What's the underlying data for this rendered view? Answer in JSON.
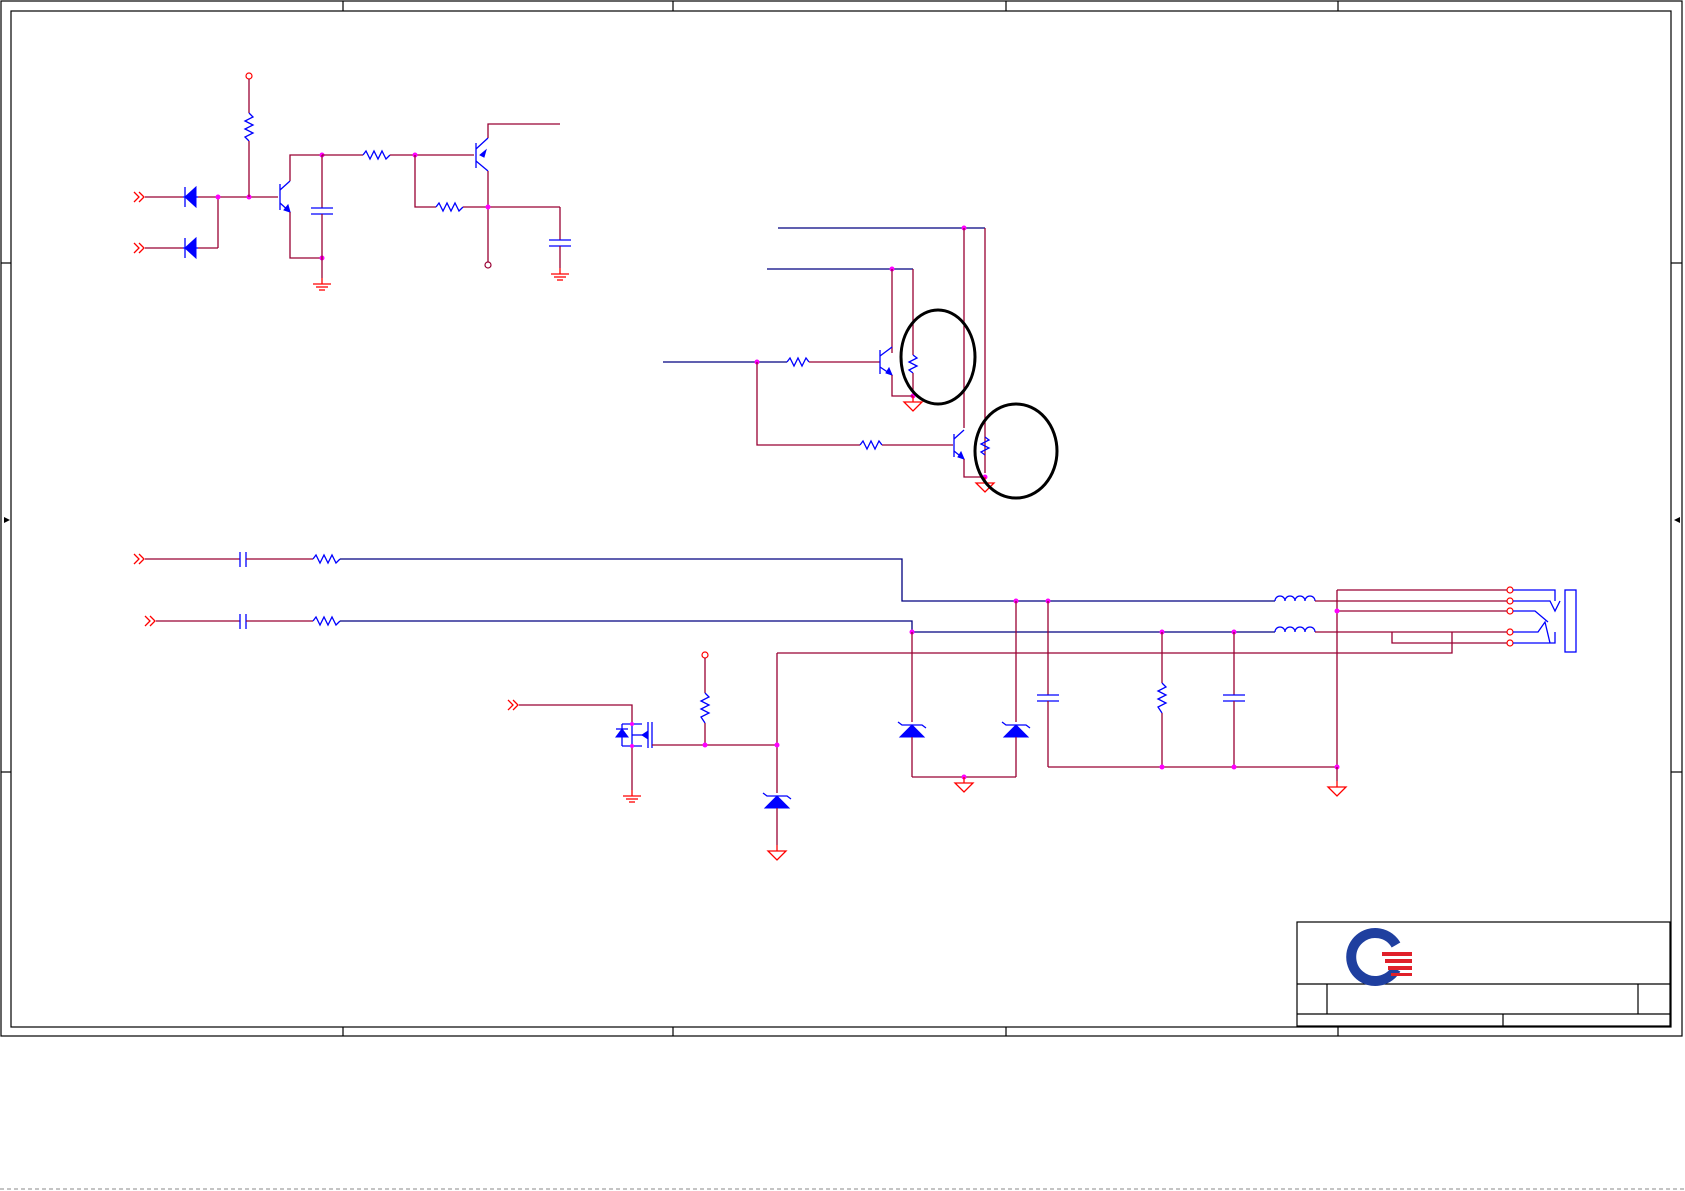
{
  "sheet": {
    "description_text": "",
    "colors": {
      "wire": "#990033",
      "component": "#0000ff",
      "power_ground": "#ff0000",
      "junction": "#ff00ff",
      "frame": "#000000",
      "logo_blue": "#1f3f9f",
      "logo_red": "#e0202a"
    },
    "icons": [
      "resistor-icon",
      "capacitor-icon",
      "diode-icon",
      "zener-icon",
      "npn-transistor-icon",
      "mosfet-icon",
      "inductor-icon",
      "ground-icon",
      "offpage-connector-icon",
      "audio-jack-icon",
      "company-logo-icon"
    ]
  }
}
